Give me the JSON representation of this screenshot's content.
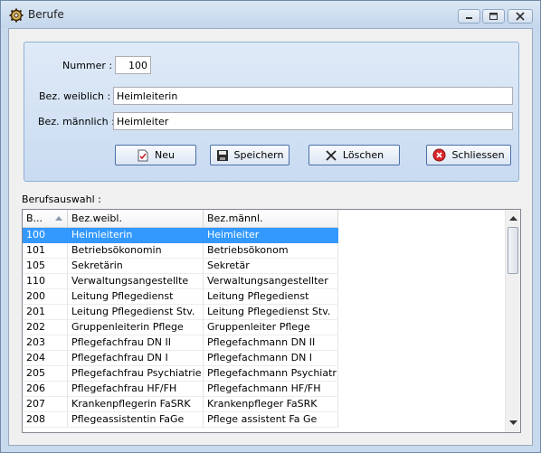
{
  "window": {
    "title": "Berufe"
  },
  "form": {
    "nummer_label": "Nummer :",
    "nummer_value": "100",
    "weiblich_label": "Bez. weiblich :",
    "weiblich_value": "Heimleiterin",
    "maennlich_label": "Bez. männlich :",
    "maennlich_value": "Heimleiter"
  },
  "buttons": {
    "neu": "Neu",
    "speichern": "Speichern",
    "loeschen": "Löschen",
    "schliessen": "Schliessen"
  },
  "list": {
    "label": "Berufsauswahl :",
    "columns": [
      "B...",
      "Bez.weibl.",
      "Bez.männl."
    ],
    "rows": [
      [
        "100",
        "Heimleiterin",
        "Heimleiter"
      ],
      [
        "101",
        "Betriebsökonomin",
        "Betriebsökonom"
      ],
      [
        "105",
        "Sekretärin",
        "Sekretär"
      ],
      [
        "110",
        "Verwaltungsangestellte",
        "Verwaltungsangestellter"
      ],
      [
        "200",
        "Leitung Pflegedienst",
        "Leitung Pflegedienst"
      ],
      [
        "201",
        "Leitung Pflegedienst Stv.",
        "Leitung Pflegedienst Stv."
      ],
      [
        "202",
        "Gruppenleiterin Pflege",
        "Gruppenleiter Pflege"
      ],
      [
        "203",
        "Pflegefachfrau DN II",
        "Pflegefachmann DN II"
      ],
      [
        "204",
        "Pflegefachfrau DN I",
        "Pflegefachmann DN I"
      ],
      [
        "205",
        "Pflegefachfrau Psychiatrie",
        "Pflegefachmann Psychiatrie"
      ],
      [
        "206",
        "Pflegefachfrau HF/FH",
        "Pflegefachmann HF/FH"
      ],
      [
        "207",
        "Krankenpflegerin FaSRK",
        "Krankenpfleger FaSRK"
      ],
      [
        "208",
        "Pflegeassistentin FaGe",
        "Pflege assistent Fa Ge"
      ]
    ],
    "selected_index": 0
  },
  "icons": {
    "app": "gear-icon",
    "neu": "new-document-icon",
    "speichern": "floppy-disk-icon",
    "loeschen": "x-icon",
    "schliessen": "red-circle-x-icon"
  },
  "colors": {
    "selection": "#3399ff",
    "group_bg": "#d6e4f5",
    "close_icon": "#d9262a"
  }
}
